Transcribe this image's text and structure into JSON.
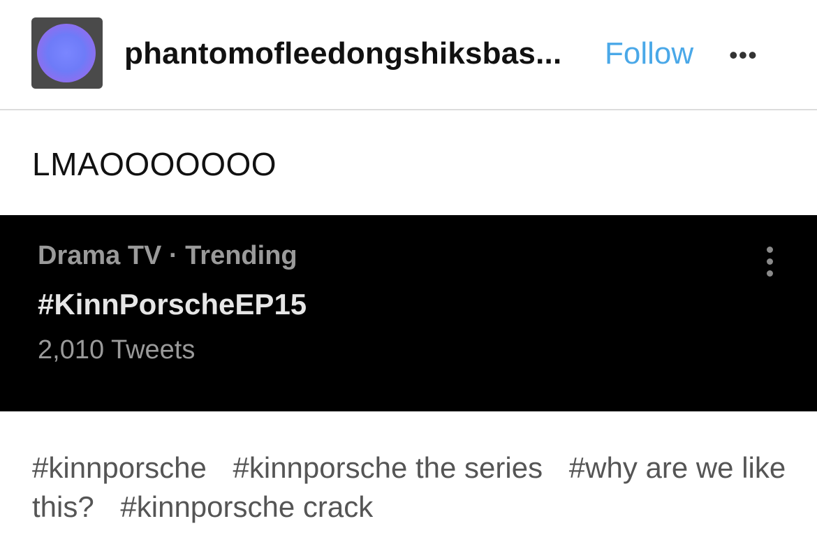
{
  "header": {
    "username": "phantomofleedongshiksbas...",
    "follow_label": "Follow",
    "more_label": "•••"
  },
  "post": {
    "text": "LMAOOOOOOO"
  },
  "trend_card": {
    "meta": "Drama TV · Trending",
    "hashtag": "#KinnPorscheEP15",
    "count": "2,010 Tweets"
  },
  "tags": [
    "#kinnporsche",
    "#kinnporsche the series",
    "#why are we like this?",
    "#kinnporsche crack"
  ],
  "colors": {
    "follow": "#4aa8e8",
    "card_bg": "#000000",
    "tag_text": "#555555"
  }
}
